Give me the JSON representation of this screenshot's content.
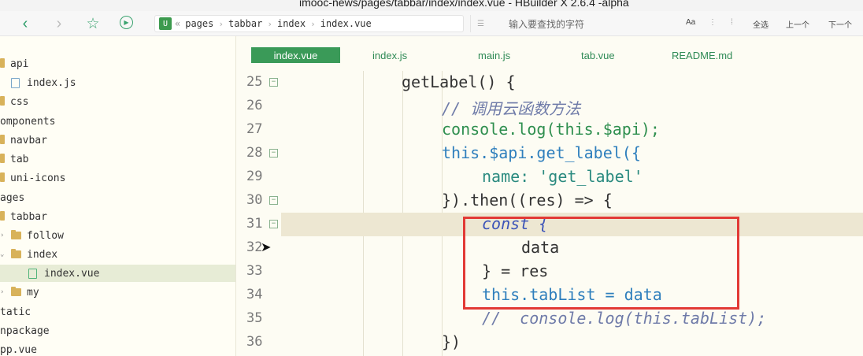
{
  "window": {
    "title": "imooc-news/pages/tabbar/index/index.vue - HBuilder X 2.6.4 -alpha"
  },
  "toolbar": {
    "breadcrumb": [
      "«",
      "pages",
      "tabbar",
      "index",
      "index.vue"
    ],
    "search_placeholder": "输入要查找的字符",
    "search_controls": [
      "Aa",
      "全选",
      "上一个",
      "下一个"
    ]
  },
  "sidebar": {
    "items": [
      {
        "label": "api",
        "type": "folder"
      },
      {
        "label": "index.js",
        "type": "file-js"
      },
      {
        "label": "css",
        "type": "folder"
      },
      {
        "label": "omponents",
        "type": "text"
      },
      {
        "label": "navbar",
        "type": "folder"
      },
      {
        "label": "tab",
        "type": "folder"
      },
      {
        "label": "uni-icons",
        "type": "folder"
      },
      {
        "label": "ages",
        "type": "text"
      },
      {
        "label": "tabbar",
        "type": "folder"
      },
      {
        "label": "follow",
        "type": "folder-collapsed"
      },
      {
        "label": "index",
        "type": "folder-open"
      },
      {
        "label": "index.vue",
        "type": "file-vue",
        "selected": true
      },
      {
        "label": "my",
        "type": "folder-collapsed"
      },
      {
        "label": "tatic",
        "type": "text"
      },
      {
        "label": "npackage",
        "type": "text"
      },
      {
        "label": "pp.vue",
        "type": "text"
      }
    ]
  },
  "tabs": [
    "index.vue",
    "index.js",
    "main.js",
    "tab.vue",
    "README.md"
  ],
  "editor": {
    "lines": [
      {
        "n": "25",
        "text": "getLabel() {"
      },
      {
        "n": "26",
        "text": "// 调用云函数方法"
      },
      {
        "n": "27",
        "text": "console.log(this.$api);"
      },
      {
        "n": "28",
        "text": "this.$api.get_label({"
      },
      {
        "n": "29",
        "text": "name: 'get_label'"
      },
      {
        "n": "30",
        "text": "}).then((res) => {"
      },
      {
        "n": "31",
        "text": "const {"
      },
      {
        "n": "32",
        "text": "data"
      },
      {
        "n": "33",
        "text": "} = res"
      },
      {
        "n": "34",
        "text": "this.tabList = data"
      },
      {
        "n": "35",
        "text": "//  console.log(this.tabList);"
      },
      {
        "n": "36",
        "text": "})"
      }
    ]
  },
  "colors": {
    "accent": "#3a9a58",
    "highlight_box": "#e23a35"
  }
}
